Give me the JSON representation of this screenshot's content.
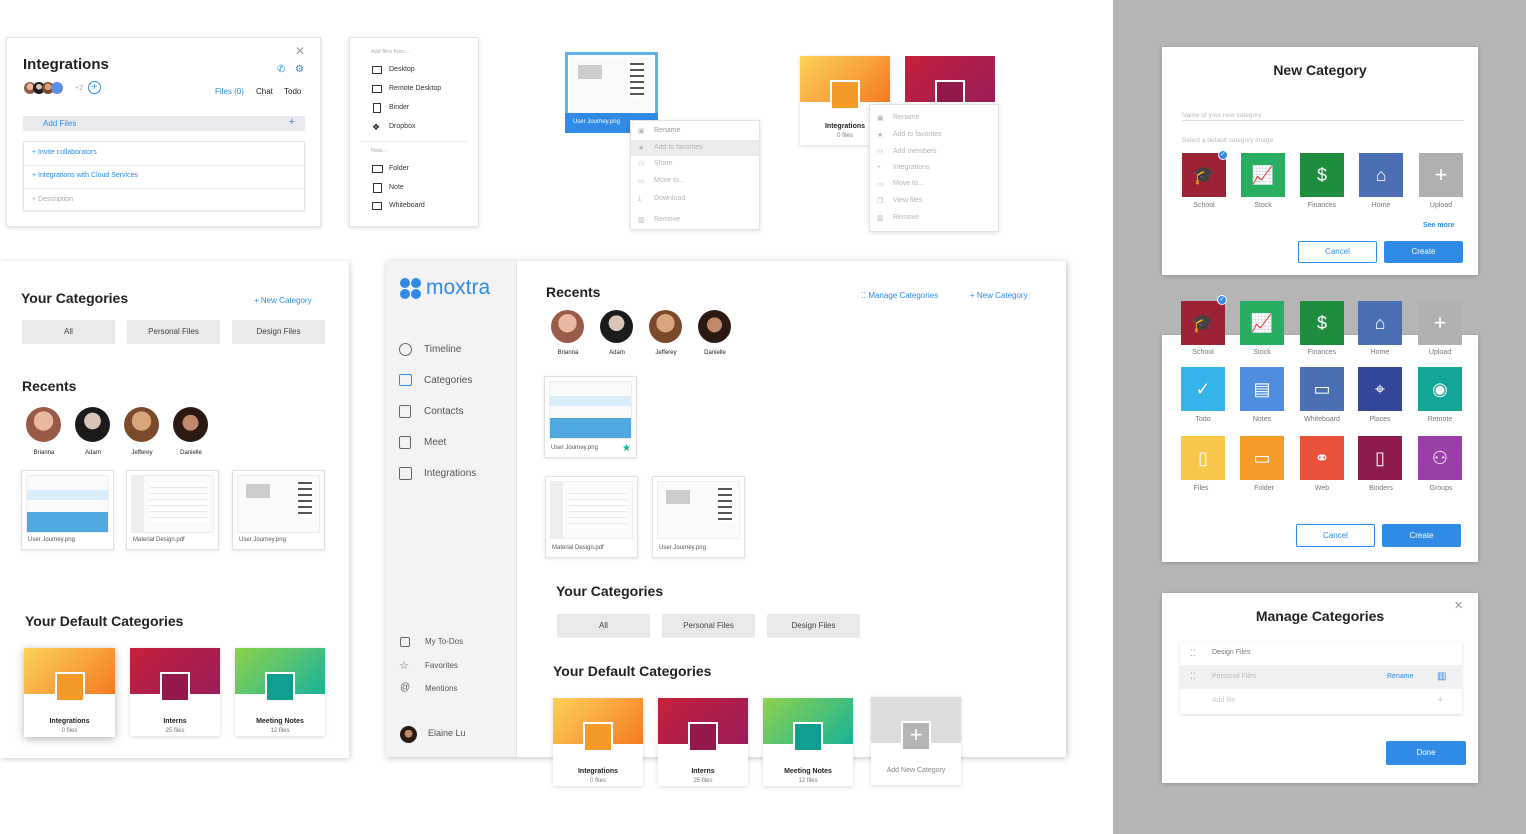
{
  "integrations_panel": {
    "title": "Integrations",
    "more_count": "+2",
    "tabs": [
      "Files (0)",
      "Chat",
      "Todo"
    ],
    "add_files": "Add Files",
    "invite": "Invite collaborators",
    "cloud": "Integrations with Cloud Services",
    "description": "Description"
  },
  "add_menu": {
    "header": "Add files from...",
    "items": [
      "Desktop",
      "Remote Desktop",
      "Binder",
      "Dropbox"
    ],
    "new_header": "New...",
    "new_items": [
      "Folder",
      "Note",
      "Whiteboard"
    ]
  },
  "file_context": {
    "file": "User Journey.png",
    "items": [
      "Rename",
      "Add to favorites",
      "Share",
      "Move to...",
      "Download",
      "Remove"
    ]
  },
  "cat_context": {
    "colors": {
      "orange": "#f47a22",
      "red": "#c6203a"
    },
    "name": "Integrations",
    "count": "0 files",
    "items": [
      "Rename",
      "Add to favorites",
      "Add members",
      "Integrations",
      "Move to...",
      "View files",
      "Remove"
    ]
  },
  "mobile": {
    "title": "Your Categories",
    "new_category": "New Category",
    "filters": [
      "All",
      "Personal Files",
      "Design Files"
    ],
    "recents_title": "Recents",
    "people": [
      "Brianna",
      "Adam",
      "Jefferey",
      "Danielle"
    ],
    "files": [
      "User Journey.png",
      "Material Design.pdf",
      "User Journey.png"
    ],
    "defaults_title": "Your Default Categories",
    "defaults": [
      {
        "name": "Integrations",
        "count": "0 files"
      },
      {
        "name": "Interns",
        "count": "25 files"
      },
      {
        "name": "Meeting Notes",
        "count": "12 files"
      }
    ]
  },
  "app": {
    "logo": "moxtra",
    "nav": [
      "Timeline",
      "Categories",
      "Contacts",
      "Meet",
      "Integrations"
    ],
    "bottom_nav": [
      "My To-Dos",
      "Favorites",
      "Mentions"
    ],
    "user": "Elaine Lu",
    "recents_title": "Recents",
    "manage": "Manage Categories",
    "new_category": "New Category",
    "people": [
      "Brianna",
      "Adam",
      "Jefferey",
      "Danielle"
    ],
    "files": [
      "User Journey.png",
      "Material Design.pdf",
      "User Journey.png"
    ],
    "categories_title": "Your Categories",
    "filters": [
      "All",
      "Personal Files",
      "Design Files"
    ],
    "defaults_title": "Your Default Categories",
    "defaults": [
      {
        "name": "Integrations",
        "count": "0 files"
      },
      {
        "name": "Interns",
        "count": "25 files"
      },
      {
        "name": "Meeting Notes",
        "count": "12 files"
      },
      {
        "name": "Add New Category",
        "count": ""
      }
    ]
  },
  "new_category": {
    "title": "New Category",
    "name_placeholder": "Name of your new category",
    "select_label": "Select a default category image",
    "options": [
      "School",
      "Stock",
      "Finances",
      "Home",
      "Upload"
    ],
    "see_more": "See more",
    "cancel": "Cancel",
    "create": "Create",
    "colors": {
      "school": "#9b2335",
      "stock": "#27ae60",
      "finances": "#1e8e3e",
      "home": "#4a6fb5",
      "upload": "#b0b0b0"
    }
  },
  "expanded": {
    "row1": [
      "School",
      "Stock",
      "Finances",
      "Home",
      "Upload"
    ],
    "row2": [
      "Todo",
      "Notes",
      "Whiteboard",
      "Places",
      "Remote"
    ],
    "row3": [
      "Files",
      "Folder",
      "Web",
      "Binders",
      "Groups"
    ],
    "cancel": "Cancel",
    "create": "Create"
  },
  "manage": {
    "title": "Manage Categories",
    "rows": [
      "Design Files",
      "Personal Files"
    ],
    "rename": "Rename",
    "add": "Add file",
    "done": "Done"
  }
}
